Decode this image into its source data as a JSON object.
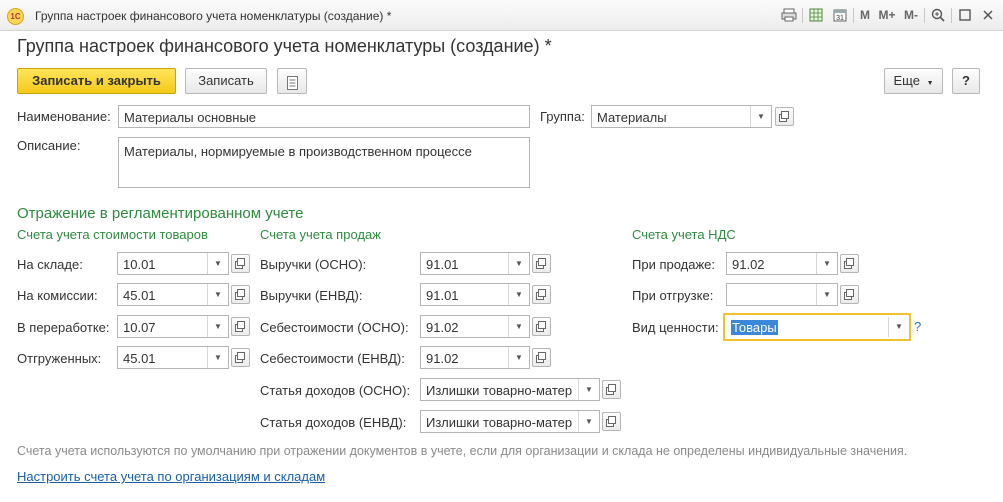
{
  "window": {
    "logo_text": "1С",
    "title": "Группа настроек финансового учета номенклатуры (создание) *",
    "tools": {
      "m": "M",
      "m_plus": "M+",
      "m_minus": "M-"
    }
  },
  "page_title": "Группа настроек финансового учета номенклатуры (создание) *",
  "toolbar": {
    "save_close": "Записать и закрыть",
    "save": "Записать",
    "more": "Еще",
    "help": "?"
  },
  "header": {
    "name_label": "Наименование:",
    "name_value": "Материалы основные",
    "group_label": "Группа:",
    "group_value": "Материалы",
    "desc_label": "Описание:",
    "desc_value": "Материалы, нормируемые в производственном процессе"
  },
  "section_title": "Отражение в регламентированном учете",
  "cost": {
    "title": "Счета учета стоимости товаров",
    "rows": [
      {
        "label": "На складе:",
        "value": "10.01"
      },
      {
        "label": "На комиссии:",
        "value": "45.01"
      },
      {
        "label": "В переработке:",
        "value": "10.07"
      },
      {
        "label": "Отгруженных:",
        "value": "45.01"
      }
    ]
  },
  "sales": {
    "title": "Счета учета продаж",
    "rows": [
      {
        "label": "Выручки (ОСНО):",
        "value": "91.01"
      },
      {
        "label": "Выручки (ЕНВД):",
        "value": "91.01"
      },
      {
        "label": "Себестоимости (ОСНО):",
        "value": "91.02"
      },
      {
        "label": "Себестоимости (ЕНВД):",
        "value": "91.02"
      },
      {
        "label": "Статья доходов (ОСНО):",
        "value": "Излишки товарно-матер"
      },
      {
        "label": "Статья доходов (ЕНВД):",
        "value": "Излишки товарно-матер"
      }
    ]
  },
  "vat": {
    "title": "Счета учета НДС",
    "rows": [
      {
        "label": "При продаже:",
        "value": "91.02"
      },
      {
        "label": "При отгрузке:",
        "value": ""
      },
      {
        "label": "Вид ценности:",
        "value": "Товары"
      }
    ],
    "help": "?"
  },
  "footer": {
    "note": "Счета учета используются по умолчанию при отражении документов в учете, если для организации и склада не определены индивидуальные значения.",
    "link": "Настроить счета учета по организациям и складам"
  },
  "icons": {
    "dropdown": "triangle-down",
    "open": "open-form-icon",
    "list": "list-icon"
  }
}
